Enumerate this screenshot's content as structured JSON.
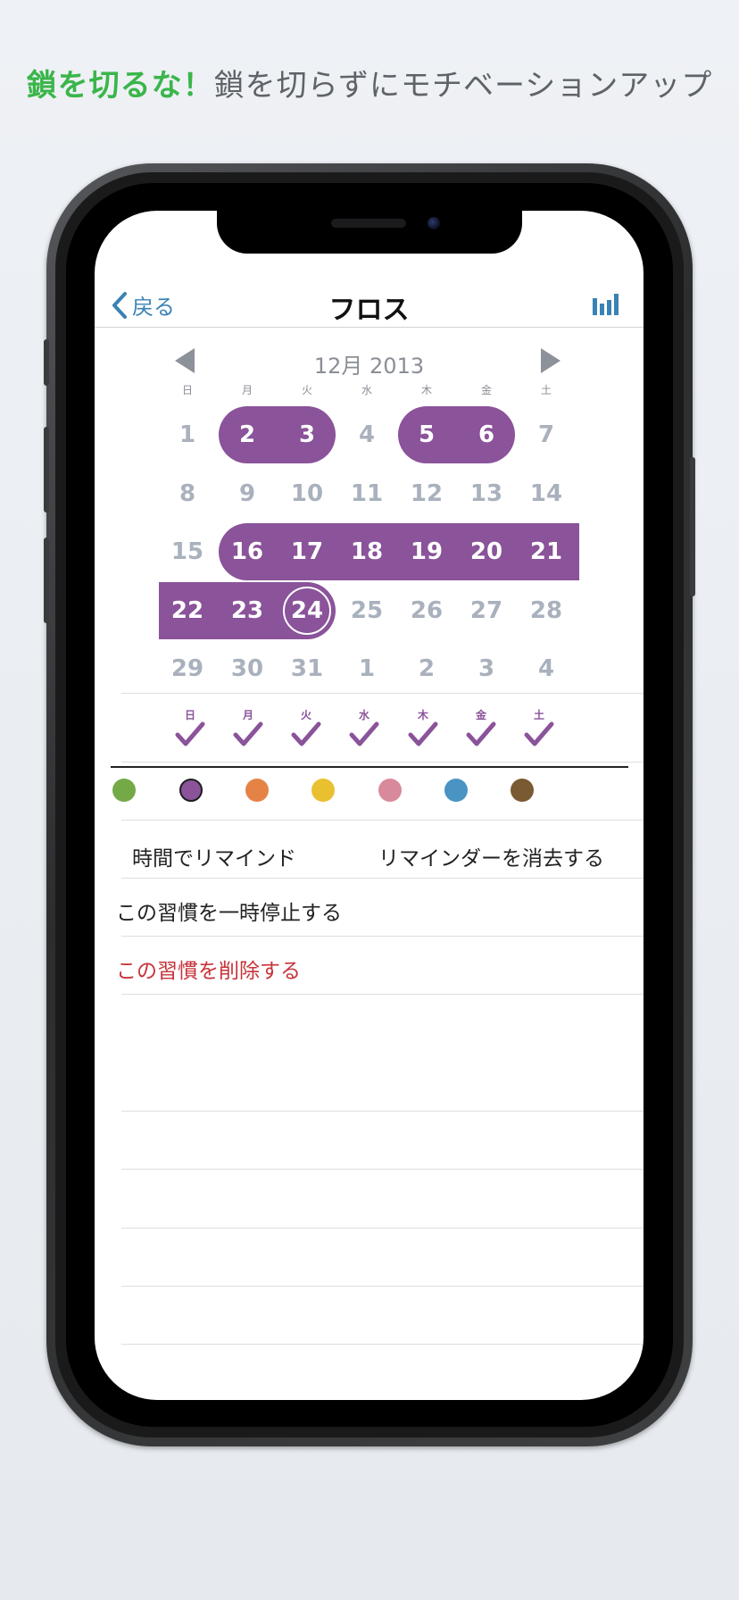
{
  "headline": {
    "accent": "鎖を切るな！",
    "rest": "鎖を切らずにモチベーションアップ"
  },
  "nav": {
    "back_label": "戻る",
    "title": "フロス",
    "stats_icon": "bar-chart-icon"
  },
  "calendar": {
    "month_label": "12月 2013",
    "weekdays": [
      "日",
      "月",
      "火",
      "水",
      "木",
      "金",
      "土"
    ],
    "weeks": [
      [
        "1",
        "2",
        "3",
        "4",
        "5",
        "6",
        "7"
      ],
      [
        "8",
        "9",
        "10",
        "11",
        "12",
        "13",
        "14"
      ],
      [
        "15",
        "16",
        "17",
        "18",
        "19",
        "20",
        "21"
      ],
      [
        "22",
        "23",
        "24",
        "25",
        "26",
        "27",
        "28"
      ],
      [
        "29",
        "30",
        "31",
        "1",
        "2",
        "3",
        "4"
      ]
    ],
    "completed_days": [
      2,
      3,
      5,
      6,
      16,
      17,
      18,
      19,
      20,
      21,
      22,
      23,
      24
    ],
    "today": 24,
    "highlight_color": "#8a539a"
  },
  "weekly_checks": {
    "days": [
      "日",
      "月",
      "火",
      "水",
      "木",
      "金",
      "土"
    ],
    "checked": [
      true,
      true,
      true,
      true,
      true,
      true,
      true
    ]
  },
  "color_options": [
    "#74a947",
    "#8a539a",
    "#e58346",
    "#e9c02f",
    "#d98a9a",
    "#4a94c4",
    "#7a5a33"
  ],
  "selected_color_index": 1,
  "reminder": {
    "time_label": "時間でリマインド",
    "clear_label": "リマインダーを消去する"
  },
  "actions": {
    "pause_label": "この習慣を一時停止する",
    "delete_label": "この習慣を削除する"
  }
}
